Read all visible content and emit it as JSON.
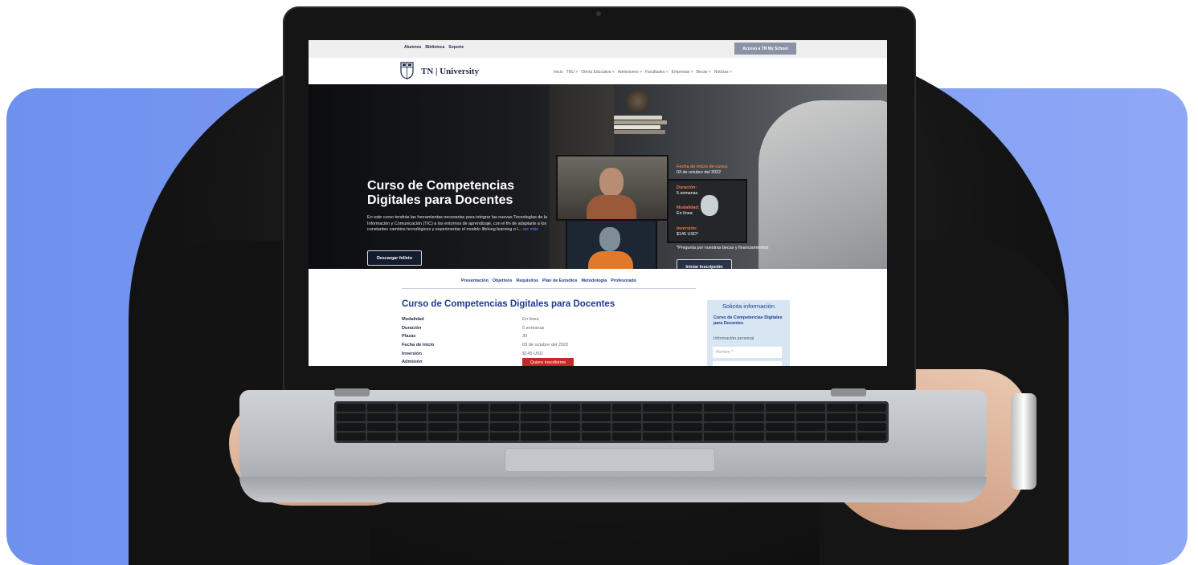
{
  "colors": {
    "background_panel": "#7f9cf2",
    "brand_navy": "#1e2a4a",
    "accent_orange": "#f07a45",
    "link_blue": "#1f3b8f",
    "cta_red": "#c62828"
  },
  "site": {
    "utility_links": [
      "Alumnos",
      "Biblioteca",
      "Soporte"
    ],
    "access_button": "Acceso a TN My School",
    "brand": "TN | University",
    "menu": [
      "Inicio",
      "TNU ˅",
      "Oferta Educativa ˅",
      "Admisiones ˅",
      "Facultades ˅",
      "Empresas ˅",
      "Becas ˅",
      "Noticias ˅"
    ]
  },
  "hero": {
    "title": "Curso de Competencias Digitales para Docentes",
    "description": "En este curso tendrás las herramientas necesarias para integrar las nuevas Tecnologías de la Información y Comunicación (TIC) a los entornos de aprendizaje, con el fin de adaptarte a los constantes cambios tecnológicos y experimentar el modelo lifelong learning o l...",
    "more_link": "ver más",
    "download_button": "Descargar folleto",
    "info": [
      {
        "label": "Fecha de inicio de curso:",
        "value": "03 de octubre del 2022"
      },
      {
        "label": "Duración:",
        "value": "5 semanas"
      },
      {
        "label": "Modalidad:",
        "value": "En línea"
      },
      {
        "label": "Inversión:",
        "value": "$145 USD*"
      }
    ],
    "note": "*Pregunta por nuestras becas y financiamientos",
    "enroll_button": "Iniciar Inscripción"
  },
  "tabs": [
    "Presentación",
    "Objetivos",
    "Requisitos",
    "Plan de Estudios",
    "Metodología",
    "Profesorado"
  ],
  "course": {
    "title": "Curso de Competencias Digitales para Docentes",
    "rows": [
      {
        "k": "Modalidad",
        "v": "En línea"
      },
      {
        "k": "Duración",
        "v": "5 semanas"
      },
      {
        "k": "Plazas",
        "v": "30"
      },
      {
        "k": "Fecha de inicio",
        "v": "03 de octubre del 2022"
      },
      {
        "k": "Inversión",
        "v": "$145 USD"
      },
      {
        "k": "Admisión",
        "v": ""
      }
    ],
    "apply_button": "Quiero inscribirme"
  },
  "sidebar": {
    "heading": "Solicita información",
    "course_name": "Curso de Competencias Digitales para Docentes",
    "section": "Información personal",
    "name_placeholder": "Nombre *"
  }
}
